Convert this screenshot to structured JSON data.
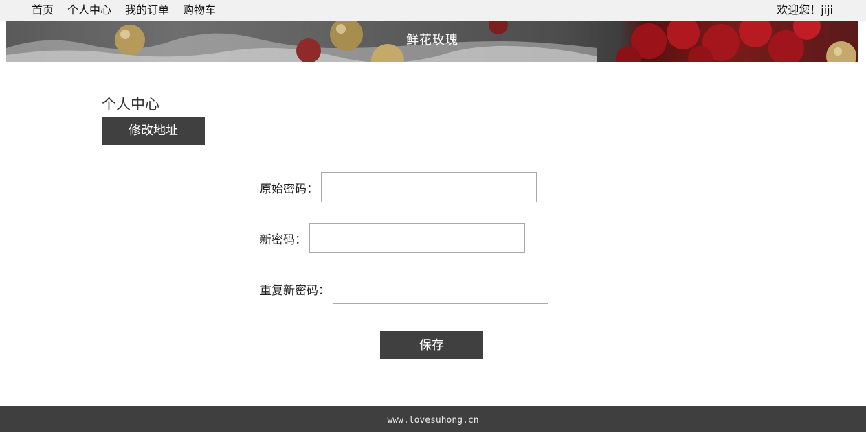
{
  "nav": {
    "items": [
      "首页",
      "个人中心",
      "我的订单",
      "购物车"
    ],
    "welcome": "欢迎您！jiji"
  },
  "banner": {
    "title": "鲜花玫瑰"
  },
  "section": {
    "title": "个人中心",
    "active_tab": "修改地址"
  },
  "form": {
    "old_password_label": "原始密码：",
    "new_password_label": "新密码：",
    "repeat_password_label": "重复新密码：",
    "old_password_value": "",
    "new_password_value": "",
    "repeat_password_value": "",
    "save_label": "保存"
  },
  "footer": {
    "text": "www.lovesuhong.cn"
  },
  "colors": {
    "topbar_bg": "#f1f1f1",
    "dark_button": "#404040",
    "footer_bg": "#3f3f3f",
    "input_border": "#a9a9a9"
  }
}
